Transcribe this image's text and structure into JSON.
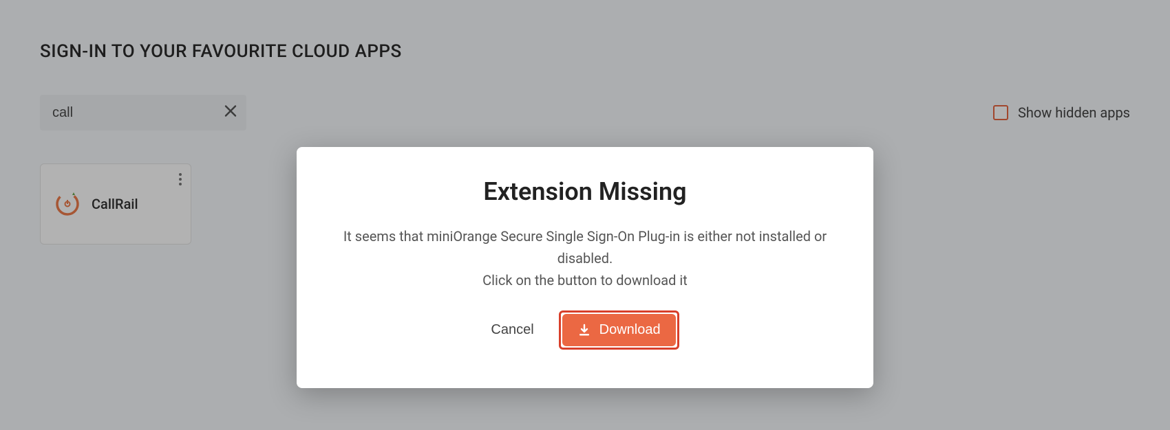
{
  "page": {
    "title": "SIGN-IN TO YOUR FAVOURITE CLOUD APPS"
  },
  "search": {
    "value": "call"
  },
  "hidden_apps": {
    "label": "Show hidden apps",
    "checked": false
  },
  "apps": [
    {
      "name": "CallRail",
      "icon": "callrail-icon"
    }
  ],
  "modal": {
    "title": "Extension Missing",
    "text_line1": "It seems that miniOrange Secure Single Sign-On Plug-in is either not installed or disabled.",
    "text_line2": "Click on the button to download it",
    "cancel_label": "Cancel",
    "download_label": "Download"
  },
  "colors": {
    "accent": "#eb6843",
    "highlight_border": "#d83f2a"
  }
}
